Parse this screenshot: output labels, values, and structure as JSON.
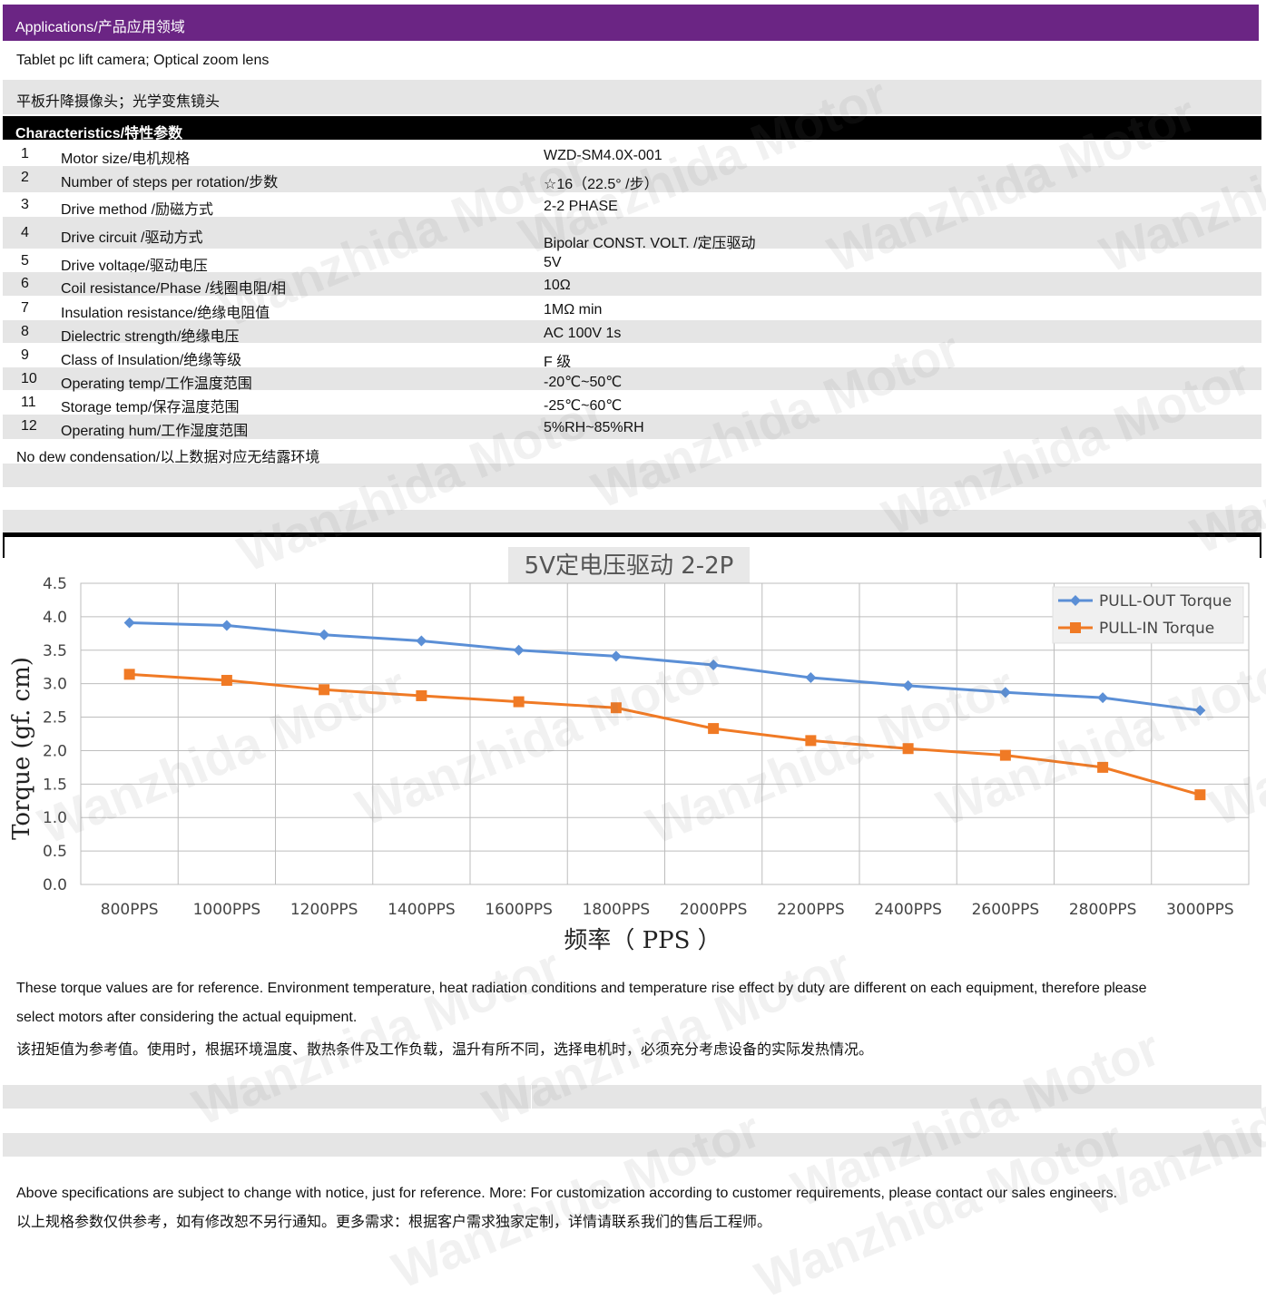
{
  "applications": {
    "header": "Applications/产品应用领域",
    "line_en": "Tablet pc lift camera; Optical zoom lens",
    "line_cn": "平板升降摄像头；光学变焦镜头"
  },
  "characteristics": {
    "header": "Characteristics/特性参数",
    "rows": [
      {
        "no": "1",
        "name": "Motor size/电机规格",
        "value": "WZD-SM4.0X-001"
      },
      {
        "no": "2",
        "name": "Number of steps per rotation/步数",
        "value": "☆16（22.5° /步）"
      },
      {
        "no": "3",
        "name": "Drive method /励磁方式",
        "value": "2-2 PHASE"
      },
      {
        "no": "4",
        "name": "Drive circuit /驱动方式",
        "value": "Bipolar CONST. VOLT. /定压驱动"
      },
      {
        "no": "5",
        "name": "Drive voltage/驱动电压",
        "value": "5V"
      },
      {
        "no": "6",
        "name": "Coil resistance/Phase /线圈电阻/相",
        "value": "10Ω"
      },
      {
        "no": "7",
        "name": "Insulation resistance/绝缘电阻值",
        "value": "1MΩ  min"
      },
      {
        "no": "8",
        "name": "Dielectric strength/绝缘电压",
        "value": "AC 100V 1s"
      },
      {
        "no": "9",
        "name": "Class of Insulation/绝缘等级",
        "value": "F 级"
      },
      {
        "no": "10",
        "name": "Operating temp/工作温度范围",
        "value": "-20℃~50℃"
      },
      {
        "no": "11",
        "name": "Storage temp/保存温度范围",
        "value": "-25℃~60℃"
      },
      {
        "no": "12",
        "name": "Operating hum/工作湿度范围",
        "value": "5%RH~85%RH"
      }
    ],
    "note": "No dew condensation/以上数据对应无结露环境"
  },
  "chart_data": {
    "type": "line",
    "title": "5V定电压驱动 2-2P",
    "xlabel": "频率（ PPS ）",
    "ylabel": "Torque (gf. cm)",
    "categories": [
      "800PPS",
      "1000PPS",
      "1200PPS",
      "1400PPS",
      "1600PPS",
      "1800PPS",
      "2000PPS",
      "2200PPS",
      "2400PPS",
      "2600PPS",
      "2800PPS",
      "3000PPS"
    ],
    "yticks": [
      "0.0",
      "0.5",
      "1.0",
      "1.5",
      "2.0",
      "2.5",
      "3.0",
      "3.5",
      "4.0",
      "4.5"
    ],
    "ylim": [
      0,
      4.5
    ],
    "grid": true,
    "legend_position": "top-right",
    "series": [
      {
        "name": "PULL-OUT Torque",
        "color": "#5b8fd6",
        "marker": "diamond",
        "values": [
          3.91,
          3.87,
          3.73,
          3.64,
          3.5,
          3.41,
          3.28,
          3.09,
          2.97,
          2.87,
          2.79,
          2.6
        ]
      },
      {
        "name": "PULL-IN  Torque",
        "color": "#f07a25",
        "marker": "square",
        "values": [
          3.14,
          3.05,
          2.91,
          2.82,
          2.73,
          2.64,
          2.33,
          2.15,
          2.03,
          1.93,
          1.75,
          1.34
        ]
      }
    ]
  },
  "notes": {
    "torque_en_1": "These torque values are for reference. Environment temperature, heat radiation conditions and temperature rise effect by duty are different on each equipment, therefore please",
    "torque_en_2": "select motors after considering the actual equipment.",
    "torque_cn": "该扭矩值为参考值。使用时，根据环境温度、散热条件及工作负载，温升有所不同，选择电机时，必须充分考虑设备的实际发热情况。",
    "spec_en": "Above specifications are subject to change with notice, just for reference. More: For customization according to customer requirements, please contact our sales engineers.",
    "spec_cn": "以上规格参数仅供参考，如有修改恕不另行通知。更多需求：根据客户需求独家定制，详情请联系我们的售后工程师。"
  },
  "watermark": {
    "text": "Wanzhida Motor",
    "color": "#787878"
  }
}
